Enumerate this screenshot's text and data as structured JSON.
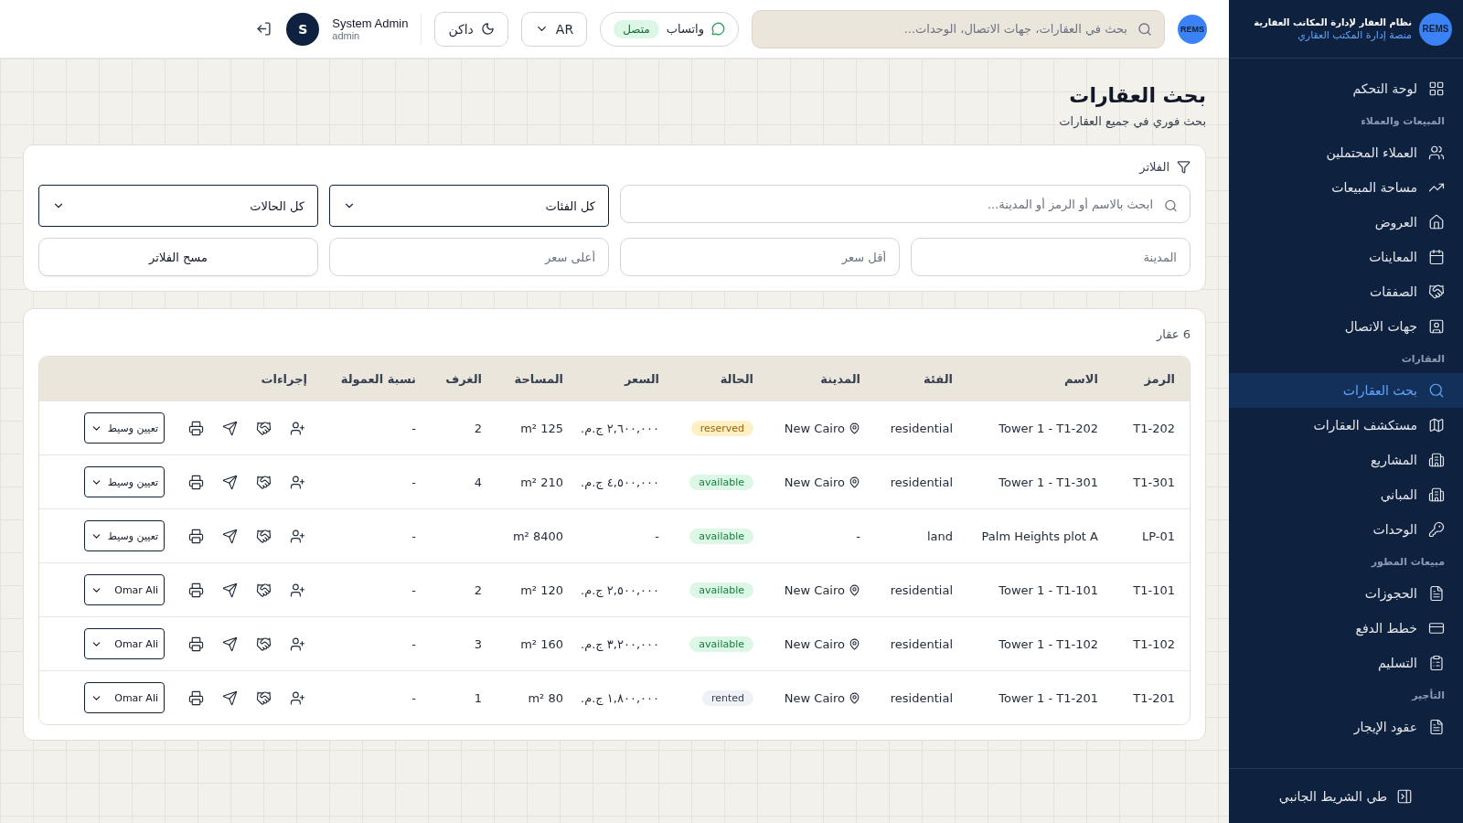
{
  "sidebar": {
    "logo_text": "REMS",
    "brand_title": "نظام العقار لإدارة المكاتب العقارية",
    "brand_subtitle": "منصة إدارة المكتب العقاري",
    "items": [
      {
        "kind": "link",
        "label": "لوحة التحكم",
        "selected": false
      },
      {
        "kind": "section",
        "label": "المبيعات والعملاء"
      },
      {
        "kind": "link",
        "label": "العملاء المحتملين",
        "selected": false
      },
      {
        "kind": "link",
        "label": "مساحة المبيعات",
        "selected": false
      },
      {
        "kind": "link",
        "label": "العروض",
        "selected": false
      },
      {
        "kind": "link",
        "label": "المعاينات",
        "selected": false
      },
      {
        "kind": "link",
        "label": "الصفقات",
        "selected": false
      },
      {
        "kind": "link",
        "label": "جهات الاتصال",
        "selected": false
      },
      {
        "kind": "section",
        "label": "العقارات"
      },
      {
        "kind": "link",
        "label": "بحث العقارات",
        "selected": true
      },
      {
        "kind": "link",
        "label": "مستكشف العقارات",
        "selected": false
      },
      {
        "kind": "link",
        "label": "المشاريع",
        "selected": false
      },
      {
        "kind": "link",
        "label": "المباني",
        "selected": false
      },
      {
        "kind": "link",
        "label": "الوحدات",
        "selected": false
      },
      {
        "kind": "section",
        "label": "مبيعات المطور"
      },
      {
        "kind": "link",
        "label": "الحجوزات",
        "selected": false
      },
      {
        "kind": "link",
        "label": "خطط الدفع",
        "selected": false
      },
      {
        "kind": "link",
        "label": "التسليم",
        "selected": false
      },
      {
        "kind": "section",
        "label": "التأجير"
      },
      {
        "kind": "link",
        "label": "عقود الإيجار",
        "selected": false
      }
    ],
    "collapse_label": "طي الشريط الجانبي"
  },
  "header": {
    "logo_text": "REMS",
    "search": {
      "placeholder": "بحث في العقارات، جهات الاتصال، الوحدات..."
    },
    "whatsapp": {
      "label": "واتساب",
      "status": "متصل",
      "connected": true
    },
    "language": "AR",
    "theme": "داكن",
    "user": {
      "initial": "S",
      "name": "System Admin",
      "role": "admin"
    }
  },
  "page": {
    "title": "بحث العقارات",
    "subtitle": "بحث فوري في جميع العقارات"
  },
  "filters": {
    "title": "الفلاتر",
    "search": {
      "placeholder": "ابحث بالاسم أو الرمز أو المدينة..."
    },
    "category": "كل الفئات",
    "status": "كل الحالات",
    "city": {
      "placeholder": "المدينة"
    },
    "min_price": {
      "placeholder": "أقل سعر"
    },
    "max_price": {
      "placeholder": "أعلى سعر"
    },
    "clear": "مسح الفلاتر"
  },
  "results": {
    "count": "6 عقار",
    "table": {
      "columns": [
        "الرمز",
        "الاسم",
        "الفئة",
        "المدينة",
        "الحالة",
        "السعر",
        "المساحة",
        "الغرف",
        "نسبة العمولة",
        "إجراءات"
      ],
      "rows": [
        {
          "code": "T1-202",
          "name": "Tower 1 - T1-202",
          "category": "residential",
          "city": "New Cairo",
          "city_pin": true,
          "status": "reserved",
          "color": "#fdf0c4",
          "price": "٢,٦٠٠,٠٠٠ ج.م.",
          "area": "125 m²",
          "rooms": "2",
          "commission": "-",
          "broker": "تعيين وسيط"
        },
        {
          "code": "T1-301",
          "name": "Tower 1 - T1-301",
          "category": "residential",
          "city": "New Cairo",
          "city_pin": true,
          "status": "available",
          "color": "#dcf7e6",
          "price": "٤,٥٠٠,٠٠٠ ج.م.",
          "area": "210 m²",
          "rooms": "4",
          "commission": "-",
          "broker": "تعيين وسيط"
        },
        {
          "code": "LP-01",
          "name": "Palm Heights plot A",
          "category": "land",
          "city": "-",
          "city_pin": false,
          "status": "available",
          "color": "#dcf7e6",
          "price": "-",
          "area": "8400 m²",
          "commission": "-",
          "broker": "تعيين وسيط"
        },
        {
          "code": "T1-101",
          "name": "Tower 1 - T1-101",
          "category": "residential",
          "city": "New Cairo",
          "city_pin": true,
          "status": "available",
          "color": "#dcf7e6",
          "price": "٢,٥٠٠,٠٠٠ ج.م.",
          "area": "120 m²",
          "rooms": "2",
          "commission": "-",
          "broker": "Omar Ali"
        },
        {
          "code": "T1-102",
          "name": "Tower 1 - T1-102",
          "category": "residential",
          "city": "New Cairo",
          "city_pin": true,
          "status": "available",
          "color": "#dcf7e6",
          "price": "٣,٢٠٠,٠٠٠ ج.م.",
          "area": "160 m²",
          "rooms": "3",
          "commission": "-",
          "broker": "Omar Ali"
        },
        {
          "code": "T1-201",
          "name": "Tower 1 - T1-201",
          "category": "residential",
          "city": "New Cairo",
          "city_pin": true,
          "status": "rented",
          "color": "#eef1f5",
          "price": "١,٨٠٠,٠٠٠ ج.م.",
          "area": "80 m²",
          "rooms": "1",
          "commission": "-",
          "broker": "Omar Ali"
        }
      ]
    }
  }
}
